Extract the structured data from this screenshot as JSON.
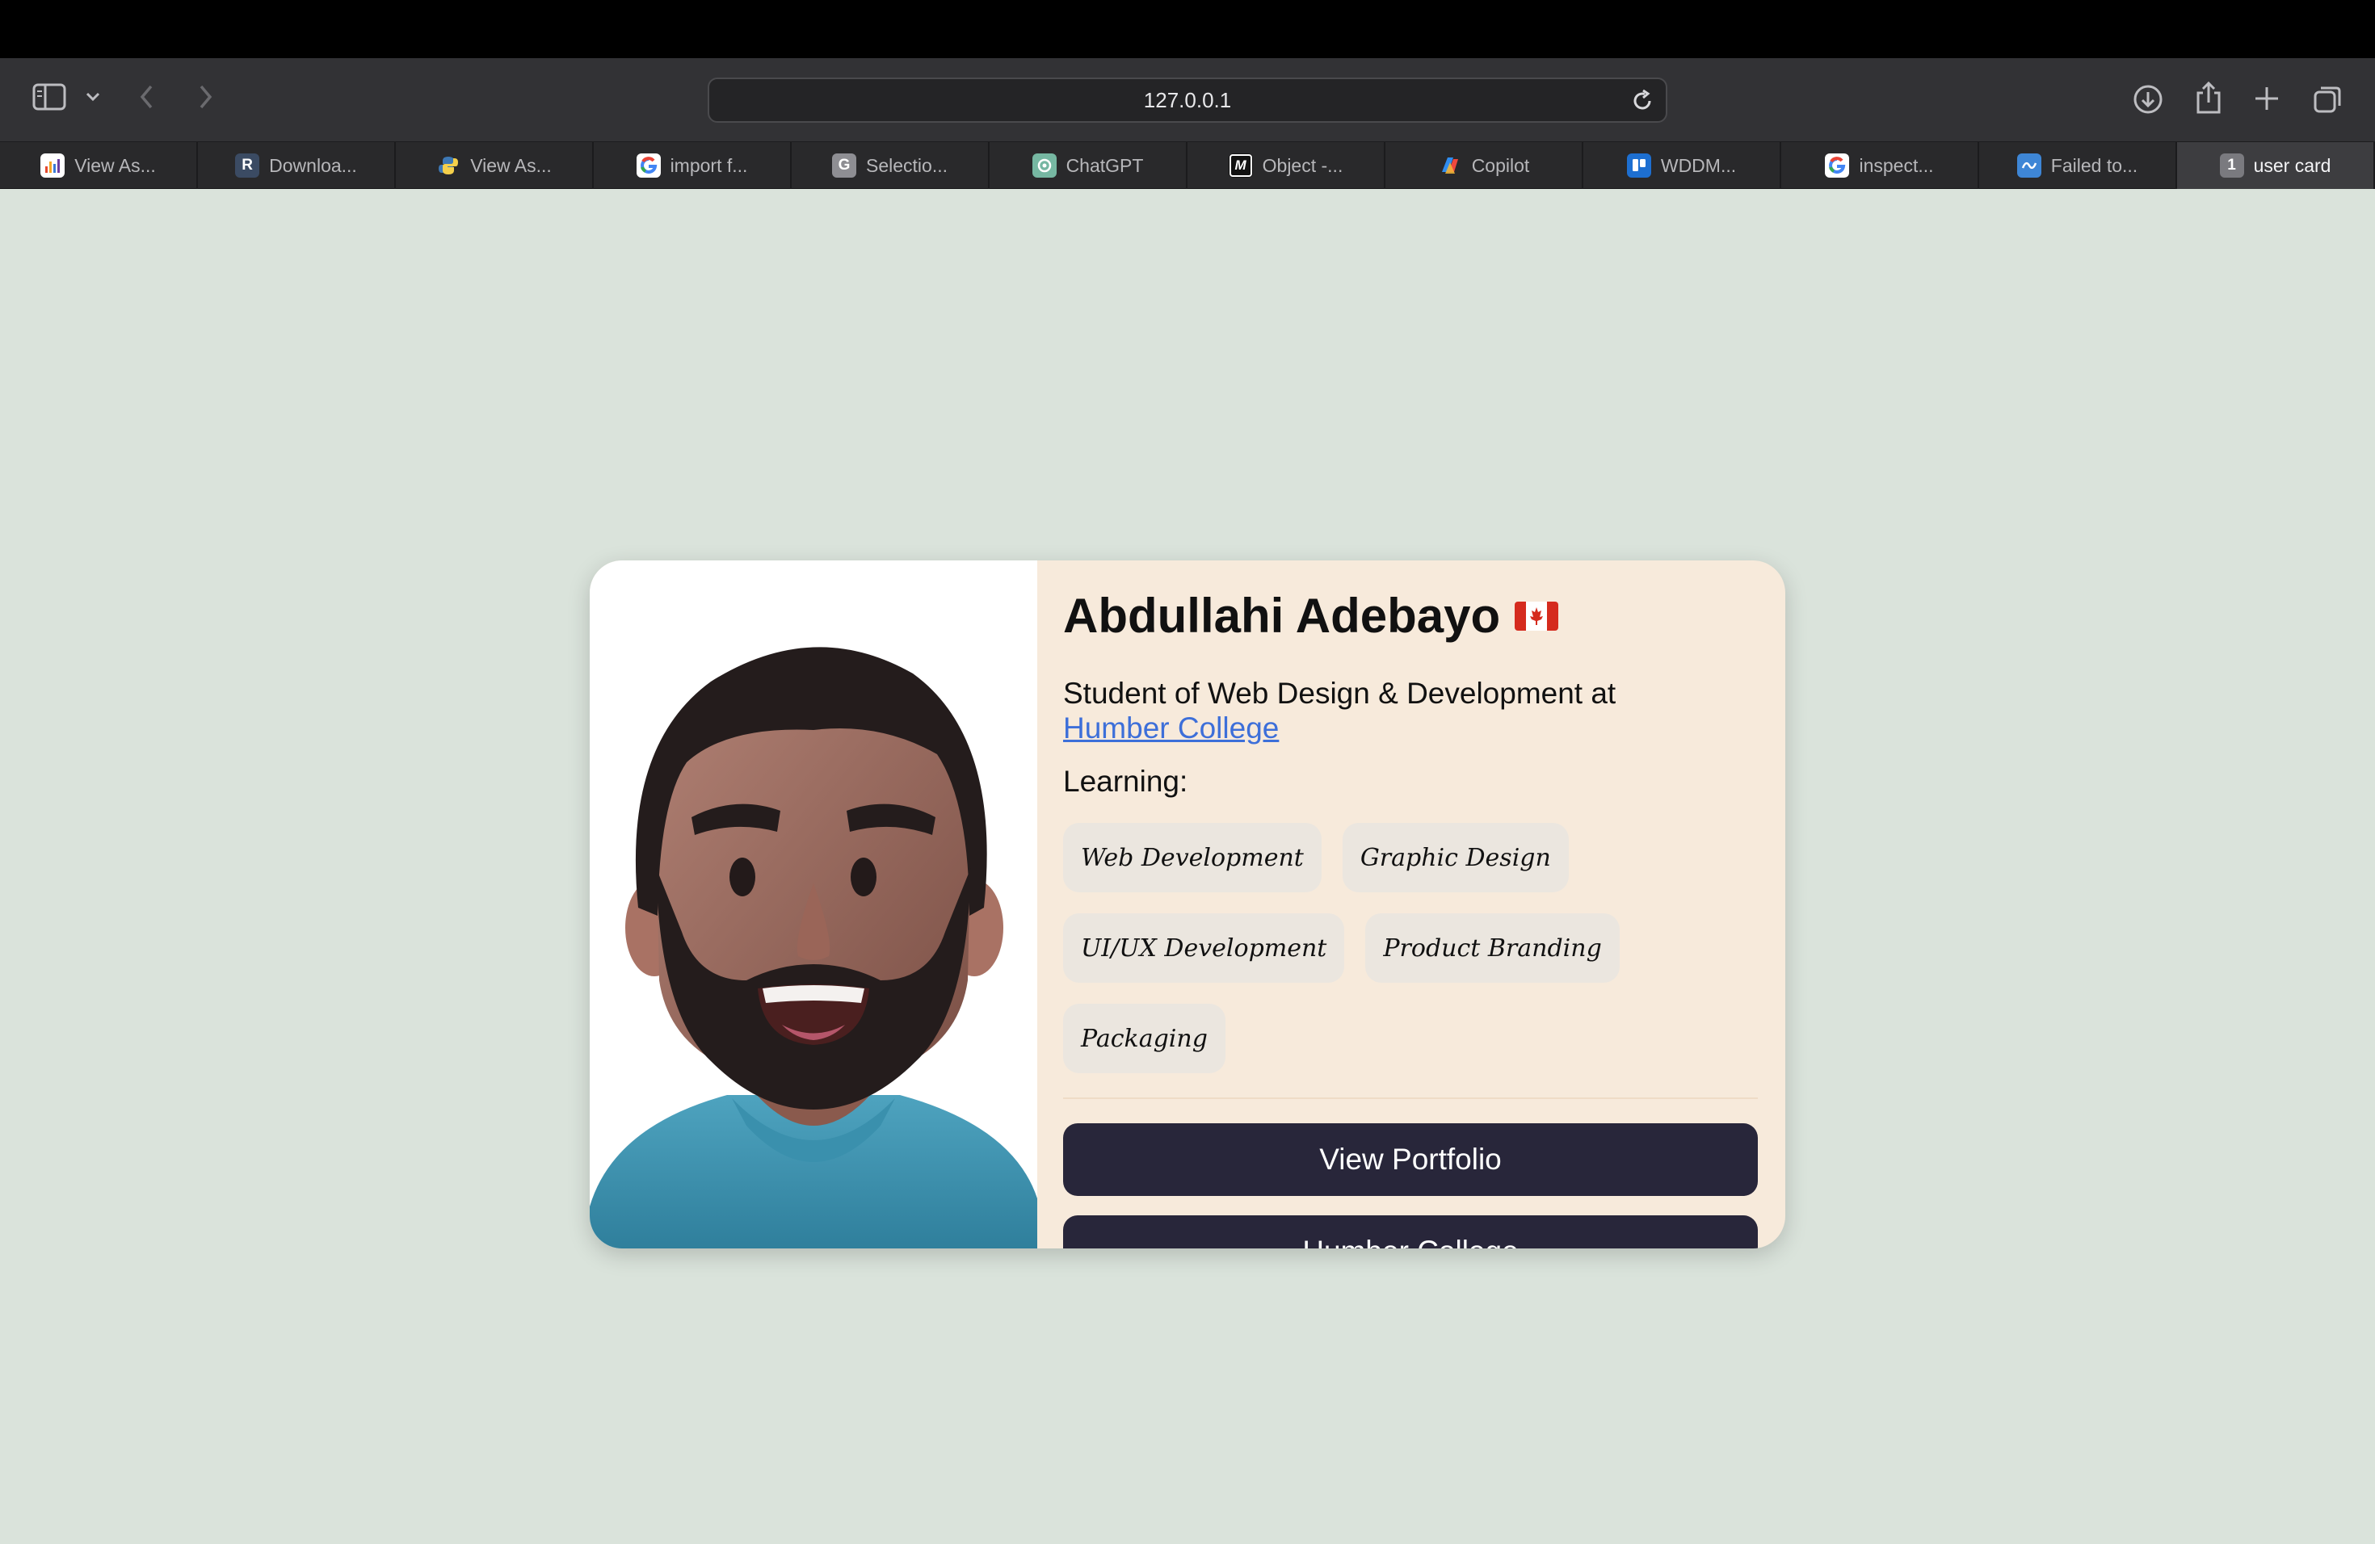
{
  "browser": {
    "url": "127.0.0.1",
    "tabs": [
      {
        "label": "View As...",
        "icon": "bar-chart-icon"
      },
      {
        "label": "Downloa...",
        "icon": "r-logo-icon"
      },
      {
        "label": "View As...",
        "icon": "python-icon"
      },
      {
        "label": "import f...",
        "icon": "google-icon"
      },
      {
        "label": "Selectio...",
        "icon": "g-letter-icon"
      },
      {
        "label": "ChatGPT",
        "icon": "chatgpt-icon"
      },
      {
        "label": "Object -...",
        "icon": "m-logo-icon"
      },
      {
        "label": "Copilot",
        "icon": "copilot-icon"
      },
      {
        "label": "WDDM...",
        "icon": "trello-icon"
      },
      {
        "label": "inspect...",
        "icon": "google-icon"
      },
      {
        "label": "Failed to...",
        "icon": "wave-icon"
      },
      {
        "label": "user card",
        "icon": "tab-number-icon",
        "badge": "1",
        "active": true
      }
    ]
  },
  "card": {
    "name": "Abdullahi Adebayo",
    "flag_icon": "canada-flag-icon",
    "description_prefix": "Student of Web Design & Development at ",
    "description_link": "Humber College",
    "learning_label": "Learning:",
    "skills": [
      "Web Development",
      "Graphic Design",
      "UI/UX Development",
      "Product Branding",
      "Packaging"
    ],
    "buttons": {
      "portfolio": "View Portfolio",
      "college": "Humber College"
    }
  },
  "colors": {
    "page_bg": "#dae3db",
    "card_bg": "#f7eadb",
    "button_bg": "#28263a",
    "link": "#3d6fd9"
  }
}
